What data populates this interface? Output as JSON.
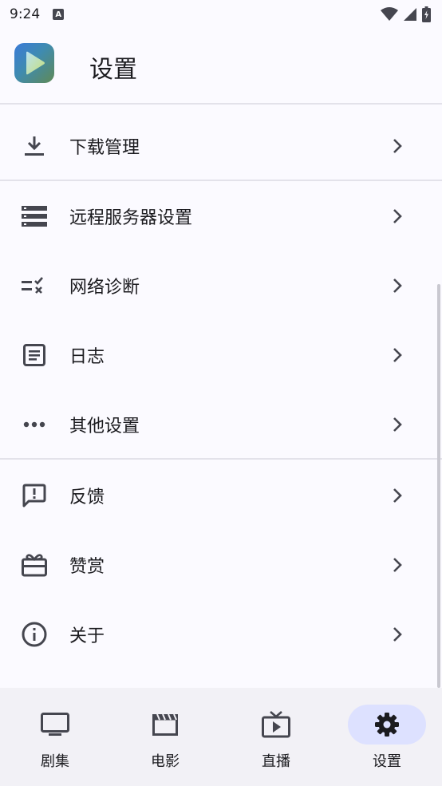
{
  "status": {
    "time": "9:24",
    "notification_icon": "a-badge-icon",
    "icons": [
      "wifi-icon",
      "cell-signal-icon",
      "battery-charging-icon"
    ]
  },
  "header": {
    "title": "设置",
    "logo_icon": "play-logo-icon"
  },
  "sections": [
    {
      "items": [
        {
          "label": "下载管理",
          "icon": "download-icon"
        }
      ]
    },
    {
      "items": [
        {
          "label": "远程服务器设置",
          "icon": "server-icon"
        },
        {
          "label": "网络诊断",
          "icon": "checklist-icon"
        },
        {
          "label": "日志",
          "icon": "document-icon"
        },
        {
          "label": "其他设置",
          "icon": "more-horiz-icon"
        }
      ]
    },
    {
      "items": [
        {
          "label": "反馈",
          "icon": "feedback-icon"
        },
        {
          "label": "赞赏",
          "icon": "gift-icon"
        },
        {
          "label": "关于",
          "icon": "info-icon"
        }
      ]
    }
  ],
  "bottom_nav": {
    "items": [
      {
        "label": "剧集",
        "icon": "tv-icon",
        "active": false
      },
      {
        "label": "电影",
        "icon": "movie-icon",
        "active": false
      },
      {
        "label": "直播",
        "icon": "live-tv-icon",
        "active": false
      },
      {
        "label": "设置",
        "icon": "gear-icon",
        "active": true
      }
    ]
  },
  "colors": {
    "background": "#fbfaff",
    "nav_background": "#f2f1f6",
    "active_pill": "#dde1ff",
    "text": "#1b1b1f",
    "icon": "#45464f",
    "divider": "#e3e2ea"
  }
}
